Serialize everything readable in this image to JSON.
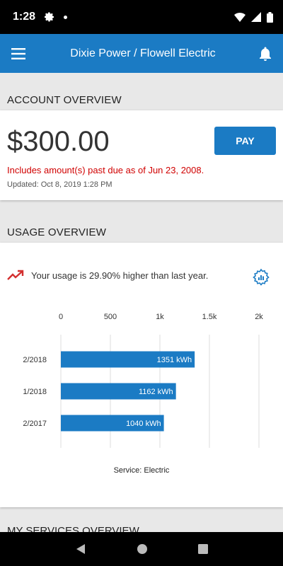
{
  "status_bar": {
    "time": "1:28"
  },
  "app_bar": {
    "title": "Dixie Power / Flowell Electric"
  },
  "account_overview": {
    "section_title": "ACCOUNT OVERVIEW",
    "amount": "$300.00",
    "pay_label": "PAY",
    "past_due_text": "Includes amount(s) past due as of Jun 23, 2008.",
    "updated_text": "Updated:  Oct 8, 2019 1:28 PM"
  },
  "usage_overview": {
    "section_title": "USAGE OVERVIEW",
    "usage_text": "Your usage is 29.90% higher than last year.",
    "service_label": "Service: Electric"
  },
  "next_section": {
    "title": "MY SERVICES OVERVIEW"
  },
  "colors": {
    "accent": "#1b7bc4",
    "alert": "#d00000",
    "trend": "#d32f2f"
  },
  "chart_data": {
    "type": "bar",
    "orientation": "horizontal",
    "categories": [
      "2/2018",
      "1/2018",
      "2/2017"
    ],
    "values": [
      1351,
      1162,
      1040
    ],
    "value_labels": [
      "1351 kWh",
      "1162 kWh",
      "1040 kWh"
    ],
    "x_ticks": [
      "0",
      "500",
      "1k",
      "1.5k",
      "2k"
    ],
    "x_tick_values": [
      0,
      500,
      1000,
      1500,
      2000
    ],
    "xlim": [
      0,
      2000
    ],
    "grid": true
  }
}
